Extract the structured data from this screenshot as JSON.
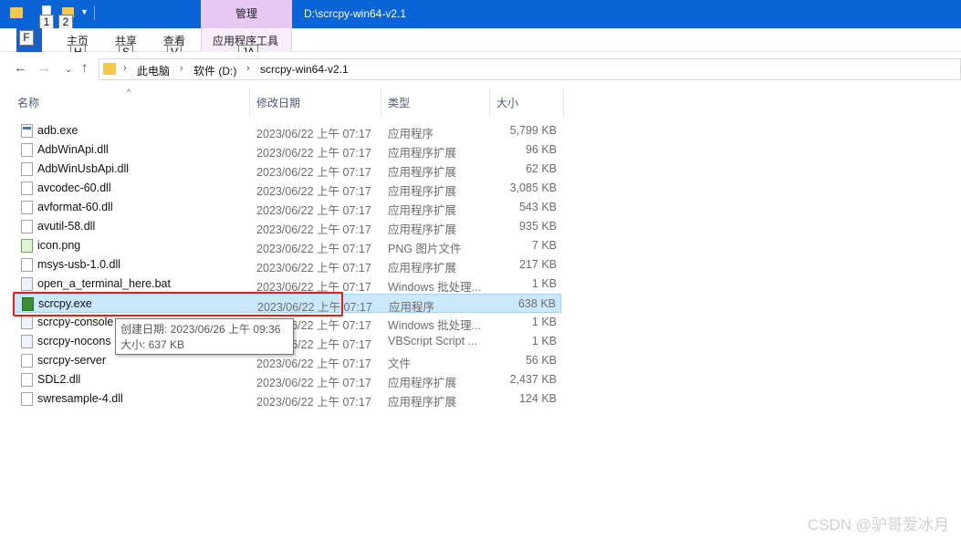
{
  "titlebar": {
    "context_tab": "管理",
    "window_title": "D:\\scrcpy-win64-v2.1"
  },
  "ribbon": {
    "tabs": [
      {
        "label": "主页",
        "keytip": "H"
      },
      {
        "label": "共享",
        "keytip": "S"
      },
      {
        "label": "查看",
        "keytip": "V"
      },
      {
        "label": "应用程序工具",
        "keytip": "JA"
      }
    ],
    "file_keytip": "F",
    "qat_keytips": [
      "1",
      "2"
    ]
  },
  "address": {
    "crumbs": [
      "此电脑",
      "软件 (D:)",
      "scrcpy-win64-v2.1"
    ]
  },
  "columns": {
    "name": "名称",
    "date": "修改日期",
    "type": "类型",
    "size": "大小"
  },
  "files": [
    {
      "name": "adb.exe",
      "date": "2023/06/22 上午 07:17",
      "type": "应用程序",
      "size": "5,799 KB",
      "icon": "exe-file-icon"
    },
    {
      "name": "AdbWinApi.dll",
      "date": "2023/06/22 上午 07:17",
      "type": "应用程序扩展",
      "size": "96 KB",
      "icon": "dll-file-icon"
    },
    {
      "name": "AdbWinUsbApi.dll",
      "date": "2023/06/22 上午 07:17",
      "type": "应用程序扩展",
      "size": "62 KB",
      "icon": "dll-file-icon"
    },
    {
      "name": "avcodec-60.dll",
      "date": "2023/06/22 上午 07:17",
      "type": "应用程序扩展",
      "size": "3,085 KB",
      "icon": "dll-file-icon"
    },
    {
      "name": "avformat-60.dll",
      "date": "2023/06/22 上午 07:17",
      "type": "应用程序扩展",
      "size": "543 KB",
      "icon": "dll-file-icon"
    },
    {
      "name": "avutil-58.dll",
      "date": "2023/06/22 上午 07:17",
      "type": "应用程序扩展",
      "size": "935 KB",
      "icon": "dll-file-icon"
    },
    {
      "name": "icon.png",
      "date": "2023/06/22 上午 07:17",
      "type": "PNG 图片文件",
      "size": "7 KB",
      "icon": "png-file-icon"
    },
    {
      "name": "msys-usb-1.0.dll",
      "date": "2023/06/22 上午 07:17",
      "type": "应用程序扩展",
      "size": "217 KB",
      "icon": "dll-file-icon"
    },
    {
      "name": "open_a_terminal_here.bat",
      "date": "2023/06/22 上午 07:17",
      "type": "Windows 批处理...",
      "size": "1 KB",
      "icon": "bat-file-icon"
    },
    {
      "name": "scrcpy.exe",
      "date": "2023/06/22 上午 07:17",
      "type": "应用程序",
      "size": "638 KB",
      "icon": "app-file-icon"
    },
    {
      "name": "scrcpy-console",
      "date": "2023/06/22 上午 07:17",
      "type": "Windows 批处理...",
      "size": "1 KB",
      "icon": "bat-file-icon"
    },
    {
      "name": "scrcpy-nocons",
      "date": "2023/06/22 上午 07:17",
      "type": "VBScript Script ...",
      "size": "1 KB",
      "icon": "vbs-file-icon"
    },
    {
      "name": "scrcpy-server",
      "date": "2023/06/22 上午 07:17",
      "type": "文件",
      "size": "56 KB",
      "icon": "generic-file-icon"
    },
    {
      "name": "SDL2.dll",
      "date": "2023/06/22 上午 07:17",
      "type": "应用程序扩展",
      "size": "2,437 KB",
      "icon": "dll-file-icon"
    },
    {
      "name": "swresample-4.dll",
      "date": "2023/06/22 上午 07:17",
      "type": "应用程序扩展",
      "size": "124 KB",
      "icon": "dll-file-icon"
    }
  ],
  "selected_file": "scrcpy.exe",
  "tooltip": {
    "created": "创建日期: 2023/06/26 上午 09:36",
    "size": "大小: 637 KB"
  },
  "watermark": "CSDN @驴哥爱冰月",
  "colors": {
    "titlebar": "#0a64d6",
    "context_tab": "#e6c8f3",
    "selection": "#cce8ff",
    "highlight_box": "#e0201b"
  }
}
